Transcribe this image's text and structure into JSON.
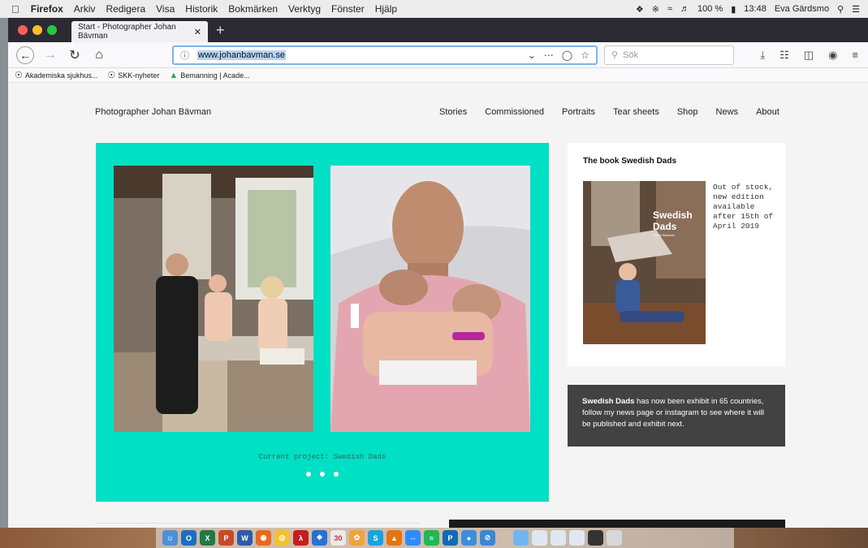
{
  "menubar": {
    "app": "Firefox",
    "items": [
      "Arkiv",
      "Redigera",
      "Visa",
      "Historik",
      "Bokmärken",
      "Verktyg",
      "Fönster",
      "Hjälp"
    ],
    "battery": "100 %",
    "time": "13:48",
    "user": "Eva Gärdsmo"
  },
  "browser": {
    "tab_title": "Start - Photographer Johan Bävman",
    "url": "www.johanbavman.se",
    "search_placeholder": "Sök",
    "bookmarks": [
      "Akademiska sjukhus...",
      "SKK-nyheter",
      "Bemanning | Acade..."
    ]
  },
  "site": {
    "title": "Photographer Johan Bävman",
    "nav": [
      "Stories",
      "Commissioned",
      "Portraits",
      "Tear sheets",
      "Shop",
      "News",
      "About"
    ],
    "hero_caption": "Current project: Swedish Dads",
    "book": {
      "heading": "The book Swedish Dads",
      "cover_title_1": "Swedish",
      "cover_title_2": "Dads",
      "cover_author": "Johan Bävman",
      "note": "Out of stock, new edition available after 15th of April 2019"
    },
    "news": {
      "bold": "Swedish Dads",
      "text": " has now been exhibit in 65 countries, follow my news page or instagram to see where it will be published and exhibit next."
    }
  },
  "colors": {
    "hero_bg": "#00e0c4",
    "news_bg": "#424242"
  }
}
